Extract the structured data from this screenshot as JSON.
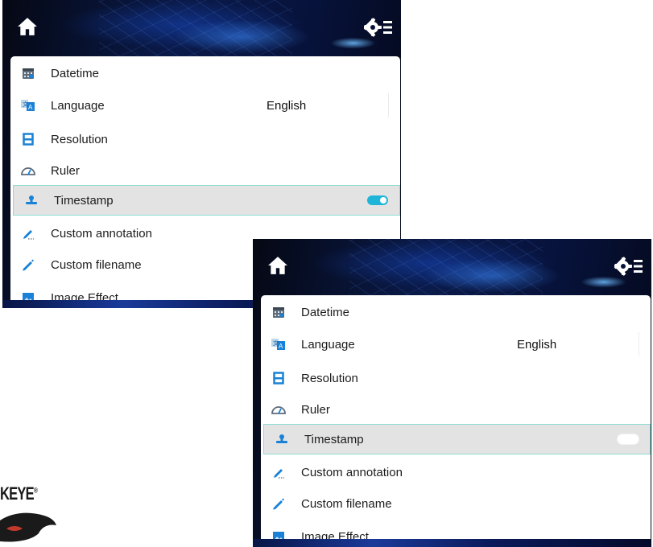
{
  "colors": {
    "accent": "#1fb5d9",
    "selected_bg": "#e3e3e3",
    "selected_border": "#8fdcd2",
    "topbar_dark": "#07123a",
    "icon_blue": "#1a82d6"
  },
  "panels": [
    {
      "icons": {
        "home": "home-icon",
        "settings": "settings-list-icon"
      },
      "menu": [
        {
          "label": "Datetime",
          "icon": "calendar-icon"
        },
        {
          "label": "Language",
          "icon": "translate-icon",
          "value": "English"
        },
        {
          "label": "Resolution",
          "icon": "resolution-icon"
        },
        {
          "label": "Ruler",
          "icon": "ruler-icon"
        },
        {
          "label": "Timestamp",
          "icon": "stamp-icon",
          "selected": true,
          "toggle": "on"
        },
        {
          "label": "Custom annotation",
          "icon": "pen-underline-icon"
        },
        {
          "label": "Custom filename",
          "icon": "pen-icon"
        },
        {
          "label": "Image Effect",
          "icon": "image-icon"
        }
      ]
    },
    {
      "icons": {
        "home": "home-icon",
        "settings": "settings-list-icon"
      },
      "menu": [
        {
          "label": "Datetime",
          "icon": "calendar-icon"
        },
        {
          "label": "Language",
          "icon": "translate-icon",
          "value": "English"
        },
        {
          "label": "Resolution",
          "icon": "resolution-icon"
        },
        {
          "label": "Ruler",
          "icon": "ruler-icon"
        },
        {
          "label": "Timestamp",
          "icon": "stamp-icon",
          "selected": true,
          "toggle": "off"
        },
        {
          "label": "Custom annotation",
          "icon": "pen-underline-icon"
        },
        {
          "label": "Custom filename",
          "icon": "pen-icon"
        },
        {
          "label": "Image Effect",
          "icon": "image-icon"
        }
      ]
    }
  ],
  "logo": {
    "text": "KEYE",
    "mark": "®"
  }
}
